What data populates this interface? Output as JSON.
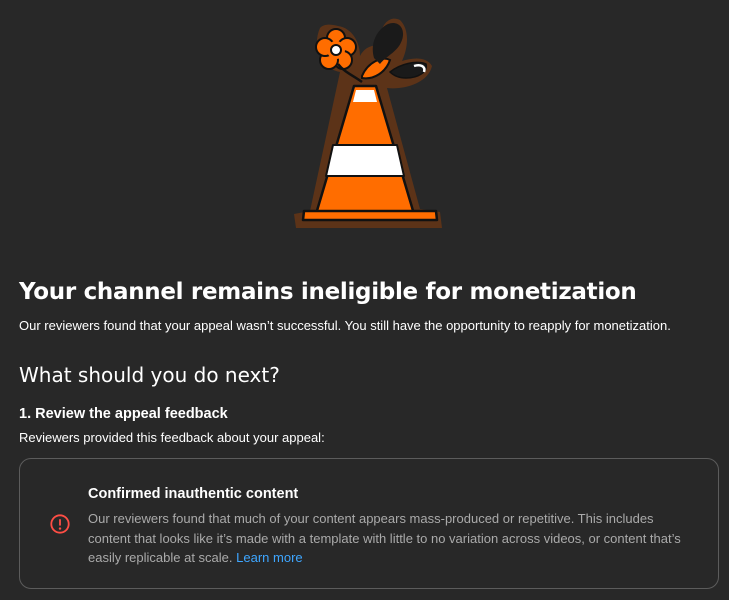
{
  "header": {
    "title": "Your channel remains ineligible for monetization",
    "subtitle": "Our reviewers found that your appeal wasn’t successful. You still have the opportunity to reapply for monetization."
  },
  "next_steps": {
    "heading": "What should you do next?",
    "steps": [
      {
        "heading": "1. Review the appeal feedback",
        "description": "Reviewers provided this feedback about your appeal:"
      }
    ]
  },
  "feedback": {
    "icon": "alert-circle-icon",
    "title": "Confirmed inauthentic content",
    "body": "Our reviewers found that much of your content appears mass-produced or repetitive. This includes content that looks like it’s made with a template with little to no variation across videos, or content that’s easily replicable at scale.",
    "link_label": "Learn more"
  },
  "colors": {
    "background": "#282828",
    "card_border": "#5c5c5c",
    "link": "#3ea6ff",
    "alert": "#ff4e45",
    "cone_orange": "#ff6d00"
  }
}
